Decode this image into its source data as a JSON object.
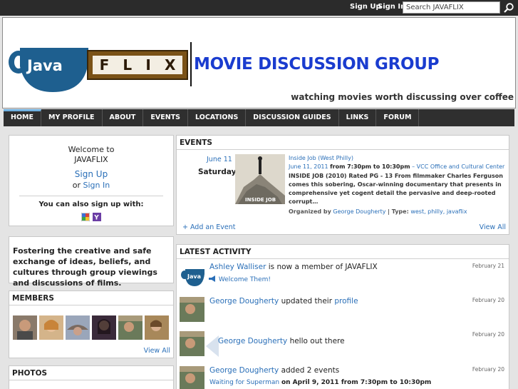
{
  "topbar": {
    "signup": "Sign Up",
    "signin": "Sign In",
    "search_value": "Search JAVAFLIX"
  },
  "header": {
    "logo_java": "Java",
    "logo_flix": [
      "F",
      "L",
      "I",
      "X"
    ],
    "title": "MOVIE DISCUSSION GROUP",
    "tagline": "watching movies worth discussing over coffee"
  },
  "nav": {
    "items": [
      "HOME",
      "MY PROFILE",
      "ABOUT",
      "EVENTS",
      "LOCATIONS",
      "DISCUSSION GUIDES",
      "LINKS",
      "FORUM"
    ]
  },
  "welcome": {
    "line1": "Welcome to",
    "line2": "JAVAFLIX",
    "signup": "Sign Up",
    "or": "or",
    "signin": "Sign In",
    "also": "You can also sign up with:"
  },
  "about": {
    "text": "Fostering the creative and safe exchange of ideas, beliefs, and cultures through group viewings and discussions of films."
  },
  "members": {
    "title": "MEMBERS",
    "view_all": "View All"
  },
  "photos": {
    "title": "PHOTOS"
  },
  "events": {
    "title": "EVENTS",
    "date": "June 11",
    "day": "Saturday",
    "poster_text": "INSIDE JOB",
    "event_title": "Inside Job (West Philly)",
    "when_date": "June 11, 2011",
    "when_from": "from 7:30pm to 10:30pm",
    "when_sep": "–",
    "where": "VCC Office and Cultural Center",
    "description": "INSIDE JOB (2010) Rated PG - 13 From filmmaker Charles Ferguson comes this sobering, Oscar-winning documentary that presents in comprehensive yet cogent detail the pervasive and deep-rooted corrupt…",
    "org_label": "Organized by",
    "organizer": "George Dougherty",
    "type_label": "| Type:",
    "types": "west, philly, javaflix",
    "add_event": "+ Add an Event",
    "view_all": "View All"
  },
  "activity": {
    "title": "LATEST ACTIVITY",
    "items": [
      {
        "who": "Ashley Walliser",
        "text": "is now a member of JAVAFLIX",
        "date": "February 21",
        "sub": "Welcome Them!"
      },
      {
        "who": "George Dougherty",
        "text": "updated their",
        "link": "profile",
        "date": "February 20"
      },
      {
        "who": "George Dougherty",
        "text": "hello out there",
        "date": "February 20"
      },
      {
        "who": "George Dougherty",
        "text": "added 2 events",
        "date": "February 20",
        "sub_link": "Waiting for Superman",
        "sub_text": "on April 9, 2011 from 7:30pm to 10:30pm"
      }
    ]
  }
}
